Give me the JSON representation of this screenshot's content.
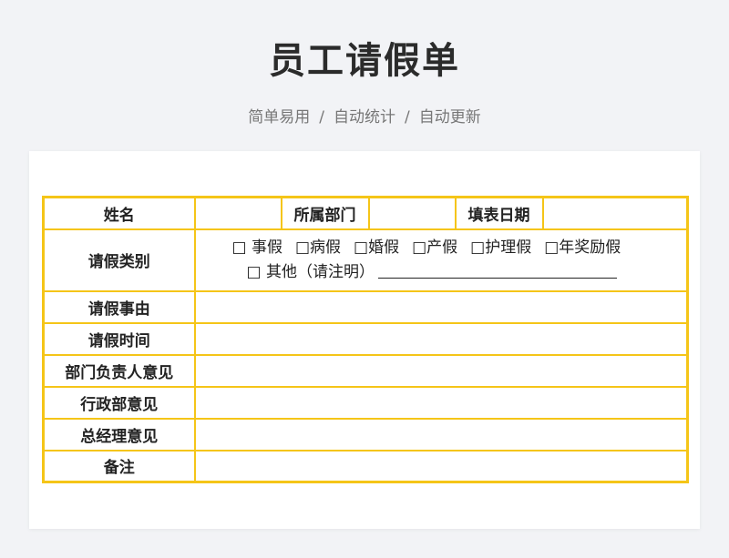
{
  "header": {
    "title": "员工请假单",
    "subtitle_parts": [
      "简单易用",
      "自动统计",
      "自动更新"
    ],
    "separator": "/"
  },
  "form": {
    "name_label": "姓名",
    "name_value": "",
    "dept_label": "所属部门",
    "dept_value": "",
    "date_label": "填表日期",
    "date_value": "",
    "leave_type_label": "请假类别",
    "leave_types": [
      "□ 事假",
      "□病假",
      "□婚假",
      "□产假",
      "□护理假",
      "□年奖励假"
    ],
    "other_option": "□  其他（请注明）",
    "rows": [
      {
        "label": "请假事由",
        "value": ""
      },
      {
        "label": "请假时间",
        "value": ""
      },
      {
        "label": "部门负责人意见",
        "value": ""
      },
      {
        "label": "行政部意见",
        "value": ""
      },
      {
        "label": "总经理意见",
        "value": ""
      },
      {
        "label": "备注",
        "value": ""
      }
    ]
  },
  "colors": {
    "border": "#f5c518",
    "background": "#f2f3f6",
    "card": "#ffffff"
  }
}
